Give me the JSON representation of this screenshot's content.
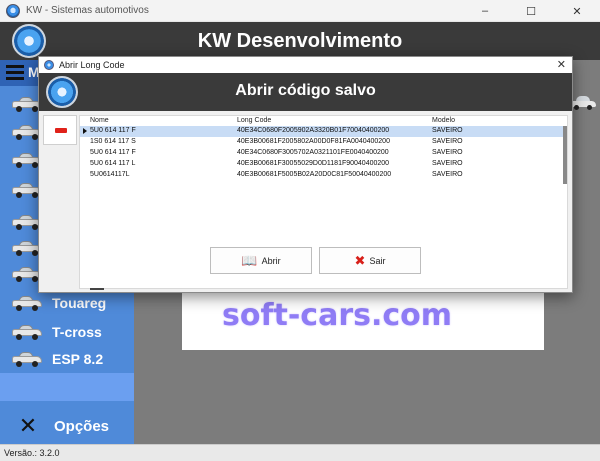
{
  "window": {
    "title": "KW - Sistemas automotivos",
    "controls": [
      "–",
      "☐",
      "✕"
    ]
  },
  "app": {
    "title": "KW Desenvolvimento",
    "menu_partial": "M"
  },
  "sidebar": {
    "items": [
      {
        "label": ""
      },
      {
        "label": ""
      },
      {
        "label": ""
      },
      {
        "label": ""
      },
      {
        "label": ""
      },
      {
        "label": ""
      },
      {
        "label": ""
      },
      {
        "label": "Touareg"
      },
      {
        "label": "T-cross"
      },
      {
        "label": "ESP 8.2"
      }
    ],
    "options_label": "Opções"
  },
  "content": {
    "watermark": "soft-cars.com"
  },
  "status": {
    "version": "Versão.: 3.2.0"
  },
  "dialog": {
    "title": "Abrir Long Code",
    "close": "✕",
    "heading": "Abrir código salvo",
    "table": {
      "columns": [
        "Nome",
        "Long Code",
        "Modelo"
      ],
      "rows": [
        {
          "nome": "5U0 614 117 F",
          "code": "40E34C0680F2005902A3320B01F70040400200",
          "modelo": "SAVEIRO"
        },
        {
          "nome": "1S0 614 117 S",
          "code": "40E3B00681F2005802A00D0F81FA0040400200",
          "modelo": "SAVEIRO"
        },
        {
          "nome": "5U0 614 117 F",
          "code": "40E34C0680F3005702A0321101FE0040400200",
          "modelo": "SAVEIRO"
        },
        {
          "nome": "5U0 614 117 L",
          "code": "40E3B00681F30055029D0D1181F90040400200",
          "modelo": "SAVEIRO"
        },
        {
          "nome": "5U0614117L",
          "code": "40E3B00681F5005B02A20D0C81F50040400200",
          "modelo": "SAVEIRO"
        }
      ]
    },
    "buttons": {
      "open": "Abrir",
      "exit": "Sair"
    }
  }
}
